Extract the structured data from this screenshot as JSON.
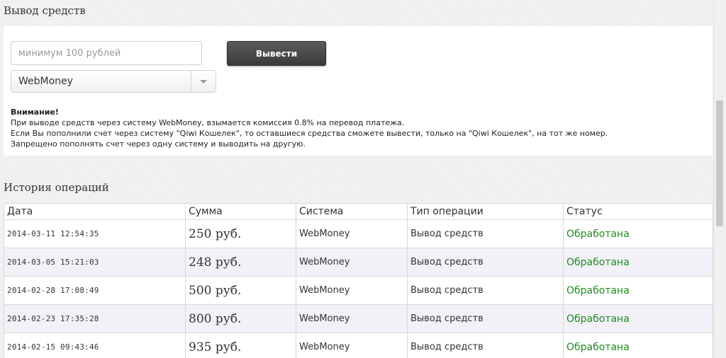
{
  "withdraw": {
    "title": "Вывод средств",
    "amount_placeholder": "минимум 100 рублей",
    "amount_value": "",
    "button_label": "Вывести",
    "system_selected": "WebMoney"
  },
  "notice": {
    "heading": "Внимание!",
    "lines": [
      "При выводе средств через систему WebMoney, взымается комиссия 0.8% на перевод платежа.",
      "Если Вы пополнили счет через систему \"Qiwi Кошелек\", то оставшиеся средства сможете вывести, только на \"Qiwi Кошелек\", на тот же номер.",
      "Запрещено пополнять счет через одну систему и выводить на другую."
    ]
  },
  "history": {
    "title": "История операций",
    "columns": [
      "Дата",
      "Сумма",
      "Система",
      "Тип операции",
      "Статус"
    ],
    "rows": [
      {
        "date": "2014-03-11 12:54:35",
        "amount": "250 руб.",
        "system": "WebMoney",
        "type": "Вывод средств",
        "status": "Обработана"
      },
      {
        "date": "2014-03-05 15:21:03",
        "amount": "248 руб.",
        "system": "WebMoney",
        "type": "Вывод средств",
        "status": "Обработана"
      },
      {
        "date": "2014-02-28 17:08:49",
        "amount": "500 руб.",
        "system": "WebMoney",
        "type": "Вывод средств",
        "status": "Обработана"
      },
      {
        "date": "2014-02-23 17:35:28",
        "amount": "800 руб.",
        "system": "WebMoney",
        "type": "Вывод средств",
        "status": "Обработана"
      },
      {
        "date": "2014-02-15 09:43:46",
        "amount": "935 руб.",
        "system": "WebMoney",
        "type": "Вывод средств",
        "status": "Обработана"
      }
    ]
  },
  "colors": {
    "status_ok": "#1e8a1e",
    "row_alt": "#f1f1f7"
  }
}
